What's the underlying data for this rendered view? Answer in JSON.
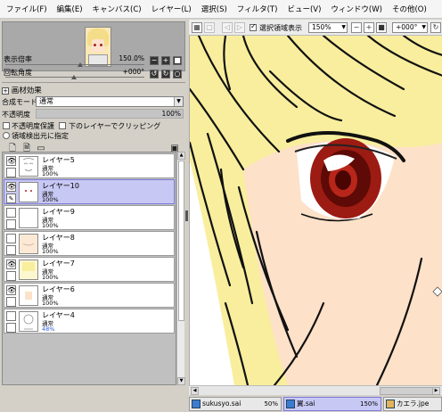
{
  "menu": [
    "ファイル(F)",
    "編集(E)",
    "キャンバス(C)",
    "レイヤー(L)",
    "選択(S)",
    "フィルタ(T)",
    "ビュー(V)",
    "ウィンドウ(W)",
    "その他(O)"
  ],
  "navigator": {
    "zoom_label": "表示倍率",
    "zoom_value": "150.0%",
    "angle_label": "回転角度",
    "angle_value": "+000°",
    "zoom_buttons": [
      "−",
      "+",
      "■"
    ],
    "angle_buttons": [
      "↺",
      "↻",
      "○"
    ]
  },
  "layer_props": {
    "section": "画材効果",
    "blend_label": "合成モード",
    "blend_value": "通常",
    "opacity_label": "不透明度",
    "opacity_value": "100%",
    "opacity_fraction": 1.0,
    "protect_label": "不透明度保護",
    "clip_label": "下のレイヤーでクリッピング",
    "selection_label": "領域検出元に指定"
  },
  "layers": [
    {
      "name": "レイヤー5",
      "mode": "通常",
      "opacity": "100%",
      "visible": true,
      "selected": false
    },
    {
      "name": "レイヤー10",
      "mode": "通常",
      "opacity": "100%",
      "visible": true,
      "selected": true
    },
    {
      "name": "レイヤー9",
      "mode": "通常",
      "opacity": "100%",
      "visible": false,
      "selected": false
    },
    {
      "name": "レイヤー8",
      "mode": "通常",
      "opacity": "100%",
      "visible": false,
      "selected": false
    },
    {
      "name": "レイヤー7",
      "mode": "通常",
      "opacity": "100%",
      "visible": true,
      "selected": false
    },
    {
      "name": "レイヤー6",
      "mode": "通常",
      "opacity": "100%",
      "visible": true,
      "selected": false
    },
    {
      "name": "レイヤー4",
      "mode": "通常",
      "opacity": "48%",
      "visible": false,
      "selected": false
    }
  ],
  "toolbar": {
    "selection_label": "選択領域表示",
    "zoom_value": "150%",
    "angle_value": "+000°"
  },
  "docs": [
    {
      "name": "sukusyo.sai",
      "zoom": "50%",
      "active": false
    },
    {
      "name": "翼.sai",
      "zoom": "150%",
      "active": true
    },
    {
      "name": "カエラ.jpe",
      "zoom": "",
      "active": false
    }
  ],
  "colors": {
    "hair": "#f8ee9d",
    "skin": "#fde1c8",
    "iris": "#9c1b12",
    "selected_layer": "#c8c8f4"
  }
}
